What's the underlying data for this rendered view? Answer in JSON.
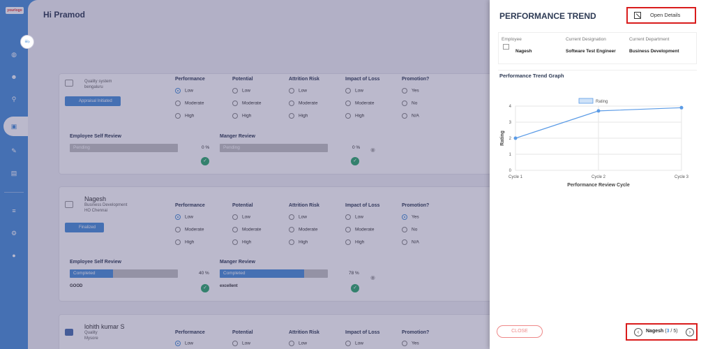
{
  "app": {
    "logo_text": "yourlogo",
    "greeting": "Hi Pramod"
  },
  "sidebar": {
    "icons": [
      "globe-icon",
      "team-icon",
      "org-icon",
      "appraisal-icon",
      "feedback-icon",
      "report-icon",
      "list-icon",
      "settings-icon",
      "user-icon"
    ],
    "active": "appraisal-icon"
  },
  "columns": [
    "Performance",
    "Potential",
    "Attrition Risk",
    "Impact of Loss",
    "Promotion?"
  ],
  "levels": [
    "Low",
    "Moderate",
    "High"
  ],
  "promotion_options": [
    "Yes",
    "No",
    "N/A"
  ],
  "review_labels": {
    "self": "Employee Self Review",
    "manager": "Manger Review"
  },
  "employees": [
    {
      "name": "",
      "department": "Quality system",
      "location": "bengaluru",
      "status": "Appraisal Initiated",
      "self_review": {
        "text": "Pending",
        "percent": "0 %",
        "fill": 0,
        "comment": ""
      },
      "manager_review": {
        "text": "Pending",
        "percent": "0 %",
        "fill": 0,
        "comment": ""
      }
    },
    {
      "name": "Nagesh",
      "department": "Business Development",
      "location": "HO Chennai",
      "status": "Finalized",
      "self_review": {
        "text": "Completed",
        "percent": "40 %",
        "fill": 0.4,
        "comment": "GOOD"
      },
      "manager_review": {
        "text": "Completed",
        "percent": "78 %",
        "fill": 0.78,
        "comment": "excellent"
      }
    },
    {
      "name": "lohith kumar S",
      "department": "Quality",
      "location": "Mysore"
    }
  ],
  "panel": {
    "title": "PERFORMANCE TREND",
    "open_details": "Open Details",
    "employee_label": "Employee",
    "employee_value": "Nagesh",
    "designation_label": "Current Designation",
    "designation_value": "Software Test Engineer",
    "department_label": "Current Department",
    "department_value": "Business Development",
    "graph_title": "Performance Trend Graph",
    "close_label": "CLOSE",
    "pager_name": "Nagesh",
    "pager_current": "3",
    "pager_total": "5"
  },
  "colors": {
    "accent": "#4a90d9",
    "success": "#2eaa6e",
    "highlight": "#d91c1c"
  },
  "chart_data": {
    "type": "line",
    "categories": [
      "Cycle 1",
      "Cycle 2",
      "Cycle 3"
    ],
    "series": [
      {
        "name": "Rating",
        "values": [
          2,
          3.7,
          3.9
        ]
      }
    ],
    "xlabel": "Performance Review Cycle",
    "ylabel": "Rating",
    "ylim": [
      0,
      4
    ],
    "yticks": [
      0,
      1,
      2,
      3,
      4
    ],
    "grid": true,
    "legend": "top-center"
  }
}
